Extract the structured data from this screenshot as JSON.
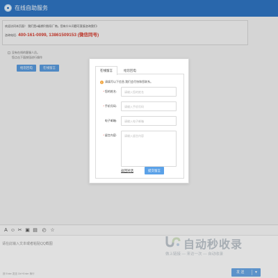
{
  "header": {
    "title": "在线自助服务"
  },
  "notice": {
    "line1": "欢迎访问本页面！ 我们是A级期刊指导厂商。您有什么问题可直接咨询我们!",
    "phone_label": "咨询电话:",
    "phone_value": "400-161-0099, 13861509153 (微信同号)"
  },
  "left_panel": {
    "line1": "没有在线的客服人员。",
    "line2": "您点击下面按钮进行操作",
    "buttons": [
      "给您回电",
      "在线留言"
    ]
  },
  "modal": {
    "tabs": [
      "在线留言",
      "给您回电"
    ],
    "active_tab": 0,
    "hint": "请填写以下信息,我们会尽快和您联系。",
    "hint_icon": "!",
    "fields": [
      {
        "label": "您的姓名:",
        "required": true,
        "placeholder": "请输入您的姓名"
      },
      {
        "label": "手机号码:",
        "required": true,
        "placeholder": "请输入手机号码"
      },
      {
        "label": "电子邮箱:",
        "required": false,
        "placeholder": "请输入电子邮箱"
      },
      {
        "label": "留言内容:",
        "required": true,
        "placeholder": "请输入留言内容"
      }
    ],
    "required_mark": "*",
    "reset_label": "返回对话",
    "submit_label": "提交留言"
  },
  "toolbar": {
    "icons": [
      {
        "name": "font-icon",
        "glyph": "A"
      },
      {
        "name": "emoji-icon",
        "glyph": "☺"
      },
      {
        "name": "scissors-icon",
        "glyph": "✂"
      },
      {
        "name": "image-icon",
        "glyph": "▣"
      },
      {
        "name": "file-icon",
        "glyph": "▤"
      },
      {
        "name": "history-icon",
        "glyph": "◴"
      },
      {
        "name": "star-icon",
        "glyph": "☆"
      }
    ]
  },
  "input": {
    "placeholder": "请在此输入文本或者粘贴QQ截图",
    "tip": "按 Enter 发送 Ctrl+Enter 换行"
  },
  "send": {
    "label": "发 送",
    "arrow": "▼"
  },
  "watermark": {
    "title": "自动秒收录",
    "subtitle": "做上链接 — 来访一次 — 自动收录"
  },
  "colors": {
    "brand": "#2f76c4",
    "button": "#5aa1e8",
    "phone": "#d53a2c"
  }
}
